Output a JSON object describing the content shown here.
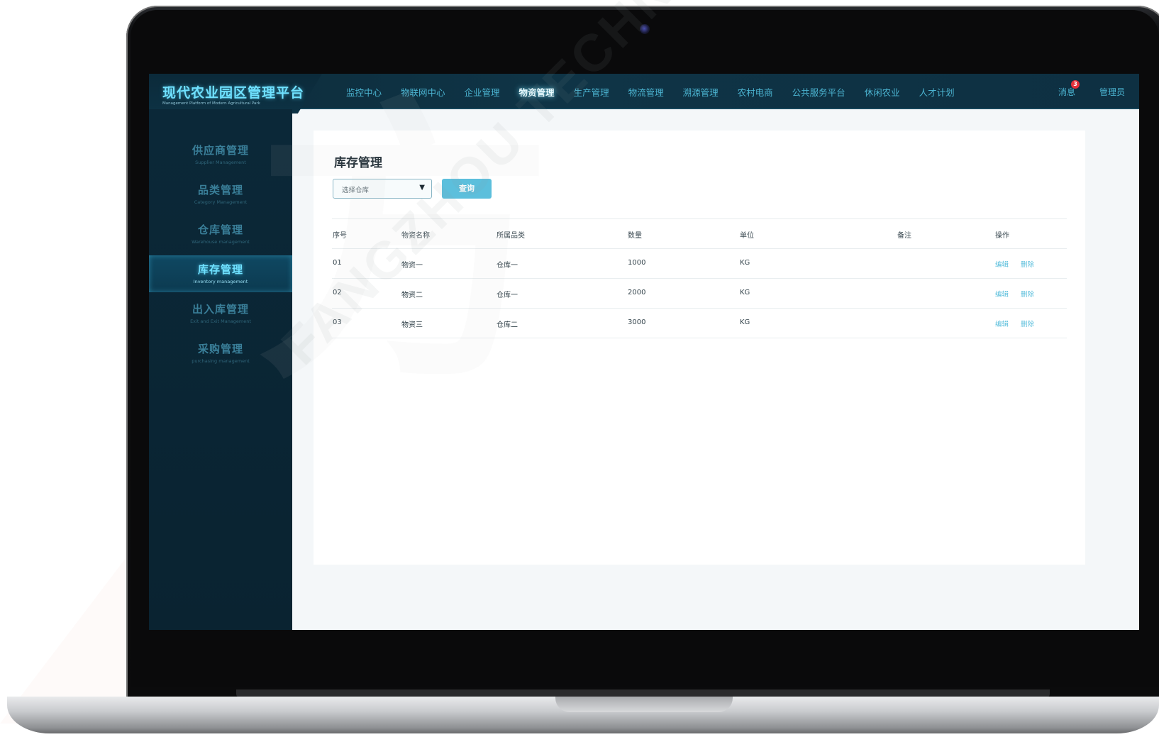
{
  "brand": {
    "title": "现代农业园区管理平台",
    "subtitle": "Management Platform of Modern Agricultural Park"
  },
  "nav": {
    "items": [
      {
        "label": "监控中心",
        "active": false
      },
      {
        "label": "物联网中心",
        "active": false
      },
      {
        "label": "企业管理",
        "active": false
      },
      {
        "label": "物资管理",
        "active": true
      },
      {
        "label": "生产管理",
        "active": false
      },
      {
        "label": "物流管理",
        "active": false
      },
      {
        "label": "溯源管理",
        "active": false
      },
      {
        "label": "农村电商",
        "active": false
      },
      {
        "label": "公共服务平台",
        "active": false
      },
      {
        "label": "休闲农业",
        "active": false
      },
      {
        "label": "人才计划",
        "active": false
      }
    ],
    "messages_label": "消息",
    "messages_count": "3",
    "admin_label": "管理员"
  },
  "sidebar": {
    "items": [
      {
        "label": "供应商管理",
        "sub": "Supplier Management",
        "active": false
      },
      {
        "label": "品类管理",
        "sub": "Category Management",
        "active": false
      },
      {
        "label": "仓库管理",
        "sub": "Warehouse management",
        "active": false
      },
      {
        "label": "库存管理",
        "sub": "Inventory management",
        "active": true
      },
      {
        "label": "出入库管理",
        "sub": "Exit and Exit Management",
        "active": false
      },
      {
        "label": "采购管理",
        "sub": "purchasing management",
        "active": false
      }
    ]
  },
  "main": {
    "title": "库存管理",
    "select_placeholder": "选择仓库",
    "query_label": "查询",
    "table": {
      "headers": [
        "序号",
        "物资名称",
        "所属品类",
        "数量",
        "单位",
        "备注",
        "操作"
      ],
      "rows": [
        {
          "no": "01",
          "name": "物资一",
          "category": "仓库一",
          "qty": "1000",
          "unit": "KG",
          "note": ""
        },
        {
          "no": "02",
          "name": "物资二",
          "category": "仓库一",
          "qty": "2000",
          "unit": "KG",
          "note": ""
        },
        {
          "no": "03",
          "name": "物资三",
          "category": "仓库二",
          "qty": "3000",
          "unit": "KG",
          "note": ""
        }
      ],
      "edit_label": "编辑",
      "delete_label": "删除"
    }
  },
  "watermark": {
    "glyphs": "方",
    "text": "FANGZHOU TECHNOLOGIES"
  },
  "colors": {
    "accent": "#5cbfdc",
    "nav_text": "#4bb4d1",
    "topbar_bg": "#0f3446",
    "sidebar_bg": "#0b2838",
    "badge": "#e5303a"
  }
}
